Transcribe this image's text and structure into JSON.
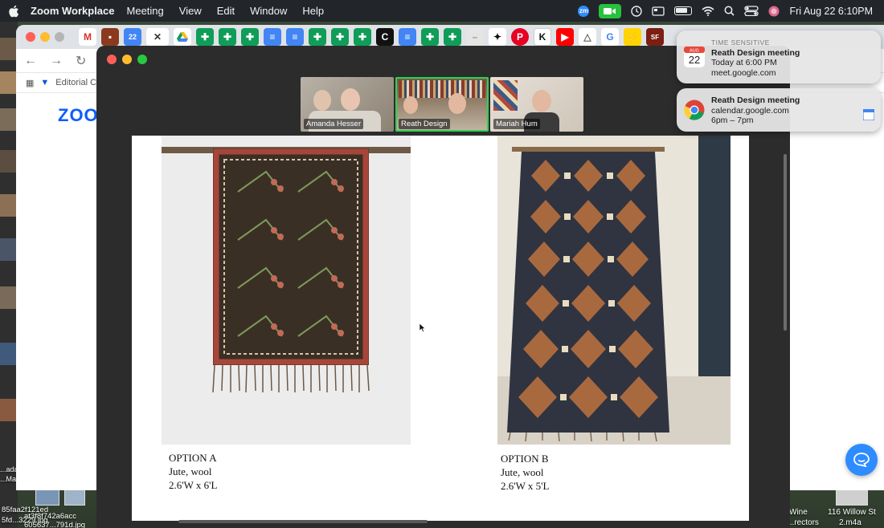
{
  "menubar": {
    "app_name": "Zoom Workplace",
    "items": [
      "Meeting",
      "View",
      "Edit",
      "Window",
      "Help"
    ],
    "clock": "Fri Aug 22  6:10PM",
    "zoom_icon_text": "zm"
  },
  "browser": {
    "bookmark_label": "Editorial C",
    "zoom_logo": "ZOO",
    "tab_icons": [
      "gmail-icon",
      "calendar-app-icon",
      "calendar-icon",
      "close-icon",
      "drive-icon",
      "sheets-icon",
      "sheets-icon",
      "sheets-icon",
      "docs-icon",
      "docs-icon",
      "sheets-icon",
      "sheets-icon",
      "sheets-icon",
      "c-icon",
      "docs-icon",
      "sheets-icon",
      "sheets-icon",
      "gray-icon",
      "pin-icon",
      "pinterest-icon",
      "k-icon",
      "youtube-icon",
      "drive-icon",
      "google-icon",
      "bolt-icon",
      "sf-icon"
    ]
  },
  "meeting": {
    "participants": [
      {
        "name": "Amanda Hesser"
      },
      {
        "name": "Reath Design"
      },
      {
        "name": "Mariah Hum"
      }
    ]
  },
  "shared_screen": {
    "option_a": {
      "title": "OPTION A",
      "material": "Jute, wool",
      "size": "2.6'W x 6'L"
    },
    "option_b": {
      "title": "OPTION B",
      "material": "Jute, wool",
      "size": "2.6'W x 5'L"
    }
  },
  "notifications": [
    {
      "header": "TIME SENSITIVE",
      "title": "Reath Design meeting",
      "line1": "Today at 6:00 PM",
      "line2": "meet.google.com",
      "calendar_month": "AUG",
      "calendar_day": "22"
    },
    {
      "title": "Reath Design meeting",
      "line1": "calendar.google.com",
      "line2": "6pm – 7pm"
    }
  ],
  "desktop": {
    "labels": [
      "85faa2f121ed",
      "at3f8f742a6acc",
      "5fd...3229.jpg",
      "605637...791d.jpg",
      "Wine",
      "...rectors",
      "116 Willow St",
      "2.m4a",
      "...ada",
      "...Ma"
    ]
  },
  "colors": {
    "zoom_blue": "#2d8cff",
    "active_speaker": "#2ed24f",
    "menubar": "#22262b"
  }
}
